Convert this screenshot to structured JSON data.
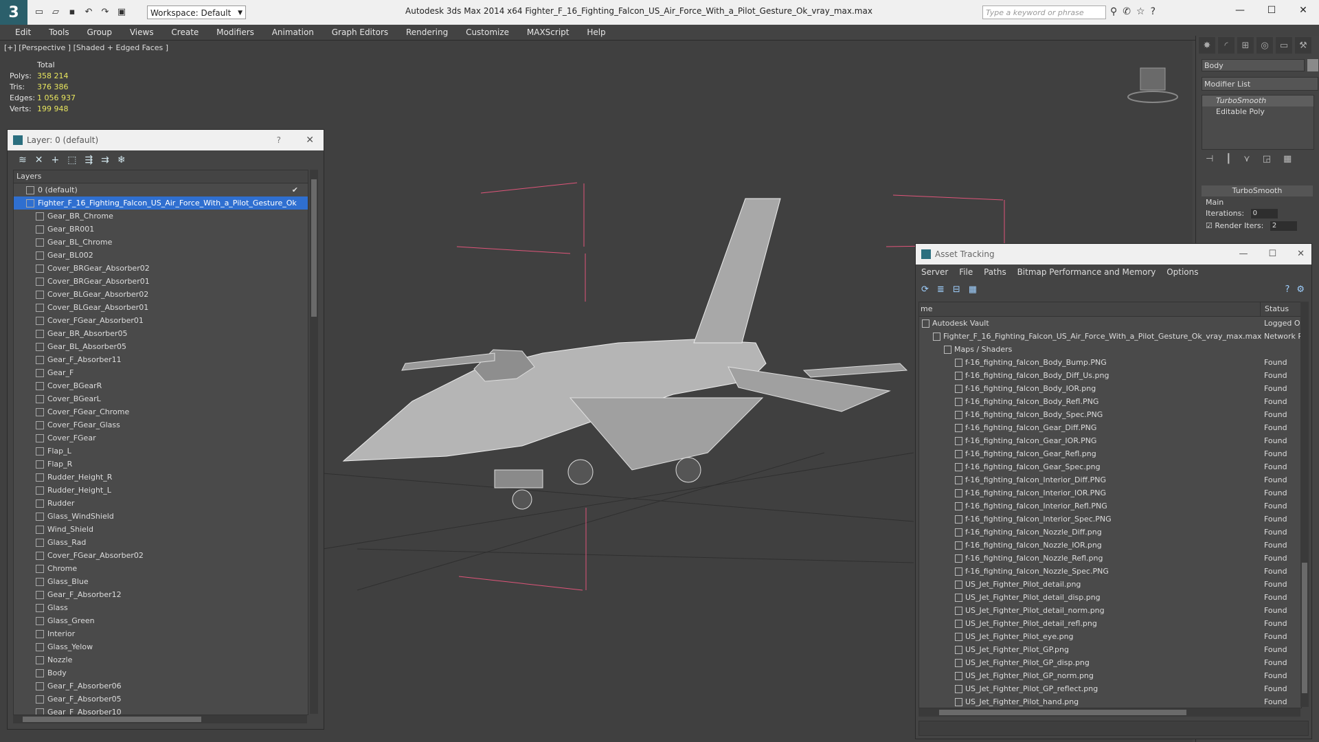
{
  "app": {
    "title": "Autodesk 3ds Max  2014 x64      Fighter_F_16_Fighting_Falcon_US_Air_Force_With_a_Pilot_Gesture_Ok_vray_max.max",
    "workspace": "Workspace: Default",
    "search_placeholder": "Type a keyword or phrase"
  },
  "menu": [
    "Edit",
    "Tools",
    "Group",
    "Views",
    "Create",
    "Modifiers",
    "Animation",
    "Graph Editors",
    "Rendering",
    "Customize",
    "MAXScript",
    "Help"
  ],
  "viewport": {
    "label": "[+] [Perspective ] [Shaded + Edged Faces ]",
    "stats_header": "Total",
    "stats": [
      {
        "k": "Polys:",
        "v": "358 214"
      },
      {
        "k": "Tris:",
        "v": "376 386"
      },
      {
        "k": "Edges:",
        "v": "1 056 937"
      },
      {
        "k": "Verts:",
        "v": "199 948"
      }
    ]
  },
  "command_panel": {
    "object_name": "Body",
    "modifier_list": "Modifier List",
    "stack": [
      "TurboSmooth",
      "Editable Poly"
    ],
    "rollout_title": "TurboSmooth",
    "main_label": "Main",
    "iterations_label": "Iterations:",
    "iterations_value": "0",
    "render_iters_label": "Render Iters:",
    "render_iters_value": "2"
  },
  "layer_window": {
    "title": "Layer: 0 (default)",
    "help": "?",
    "list_header": "Layers",
    "default_layer": "0 (default)",
    "selected_layer": "Fighter_F_16_Fighting_Falcon_US_Air_Force_With_a_Pilot_Gesture_Ok",
    "objects": [
      "Gear_BR_Chrome",
      "Gear_BR001",
      "Gear_BL_Chrome",
      "Gear_BL002",
      "Cover_BRGear_Absorber02",
      "Cover_BRGear_Absorber01",
      "Cover_BLGear_Absorber02",
      "Cover_BLGear_Absorber01",
      "Cover_FGear_Absorber01",
      "Gear_BR_Absorber05",
      "Gear_BL_Absorber05",
      "Gear_F_Absorber11",
      "Gear_F",
      "Cover_BGearR",
      "Cover_BGearL",
      "Cover_FGear_Chrome",
      "Cover_FGear_Glass",
      "Cover_FGear",
      "Flap_L",
      "Flap_R",
      "Rudder_Height_R",
      "Rudder_Height_L",
      "Rudder",
      "Glass_WindShield",
      "Wind_Shield",
      "Glass_Rad",
      "Cover_FGear_Absorber02",
      "Chrome",
      "Glass_Blue",
      "Gear_F_Absorber12",
      "Glass",
      "Glass_Green",
      "Interior",
      "Glass_Yelow",
      "Nozzle",
      "Body",
      "Gear_F_Absorber06",
      "Gear_F_Absorber05",
      "Gear_F_Absorber10"
    ]
  },
  "asset_window": {
    "title": "Asset Tracking",
    "menu": [
      "Server",
      "File",
      "Paths",
      "Bitmap Performance and Memory",
      "Options"
    ],
    "col_name": "me",
    "col_status": "Status",
    "rows": [
      {
        "name": "Autodesk Vault",
        "status": "Logged O",
        "indent": 0
      },
      {
        "name": "Fighter_F_16_Fighting_Falcon_US_Air_Force_With_a_Pilot_Gesture_Ok_vray_max.max",
        "status": "Network P",
        "indent": 1
      },
      {
        "name": "Maps / Shaders",
        "status": "",
        "indent": 2
      },
      {
        "name": "f-16_fighting_falcon_Body_Bump.PNG",
        "status": "Found",
        "indent": 3
      },
      {
        "name": "f-16_fighting_falcon_Body_Diff_Us.png",
        "status": "Found",
        "indent": 3
      },
      {
        "name": "f-16_fighting_falcon_Body_IOR.png",
        "status": "Found",
        "indent": 3
      },
      {
        "name": "f-16_fighting_falcon_Body_Refl.PNG",
        "status": "Found",
        "indent": 3
      },
      {
        "name": "f-16_fighting_falcon_Body_Spec.PNG",
        "status": "Found",
        "indent": 3
      },
      {
        "name": "f-16_fighting_falcon_Gear_Diff.PNG",
        "status": "Found",
        "indent": 3
      },
      {
        "name": "f-16_fighting_falcon_Gear_IOR.PNG",
        "status": "Found",
        "indent": 3
      },
      {
        "name": "f-16_fighting_falcon_Gear_Refl.png",
        "status": "Found",
        "indent": 3
      },
      {
        "name": "f-16_fighting_falcon_Gear_Spec.png",
        "status": "Found",
        "indent": 3
      },
      {
        "name": "f-16_fighting_falcon_Interior_Diff.PNG",
        "status": "Found",
        "indent": 3
      },
      {
        "name": "f-16_fighting_falcon_Interior_IOR.PNG",
        "status": "Found",
        "indent": 3
      },
      {
        "name": "f-16_fighting_falcon_Interior_Refl.PNG",
        "status": "Found",
        "indent": 3
      },
      {
        "name": "f-16_fighting_falcon_Interior_Spec.PNG",
        "status": "Found",
        "indent": 3
      },
      {
        "name": "f-16_fighting_falcon_Nozzle_Diff.png",
        "status": "Found",
        "indent": 3
      },
      {
        "name": "f-16_fighting_falcon_Nozzle_IOR.png",
        "status": "Found",
        "indent": 3
      },
      {
        "name": "f-16_fighting_falcon_Nozzle_Refl.png",
        "status": "Found",
        "indent": 3
      },
      {
        "name": "f-16_fighting_falcon_Nozzle_Spec.PNG",
        "status": "Found",
        "indent": 3
      },
      {
        "name": "US_Jet_Fighter_Pilot_detail.png",
        "status": "Found",
        "indent": 3
      },
      {
        "name": "US_Jet_Fighter_Pilot_detail_disp.png",
        "status": "Found",
        "indent": 3
      },
      {
        "name": "US_Jet_Fighter_Pilot_detail_norm.png",
        "status": "Found",
        "indent": 3
      },
      {
        "name": "US_Jet_Fighter_Pilot_detail_refl.png",
        "status": "Found",
        "indent": 3
      },
      {
        "name": "US_Jet_Fighter_Pilot_eye.png",
        "status": "Found",
        "indent": 3
      },
      {
        "name": "US_Jet_Fighter_Pilot_GP.png",
        "status": "Found",
        "indent": 3
      },
      {
        "name": "US_Jet_Fighter_Pilot_GP_disp.png",
        "status": "Found",
        "indent": 3
      },
      {
        "name": "US_Jet_Fighter_Pilot_GP_norm.png",
        "status": "Found",
        "indent": 3
      },
      {
        "name": "US_Jet_Fighter_Pilot_GP_reflect.png",
        "status": "Found",
        "indent": 3
      },
      {
        "name": "US_Jet_Fighter_Pilot_hand.png",
        "status": "Found",
        "indent": 3
      }
    ]
  }
}
